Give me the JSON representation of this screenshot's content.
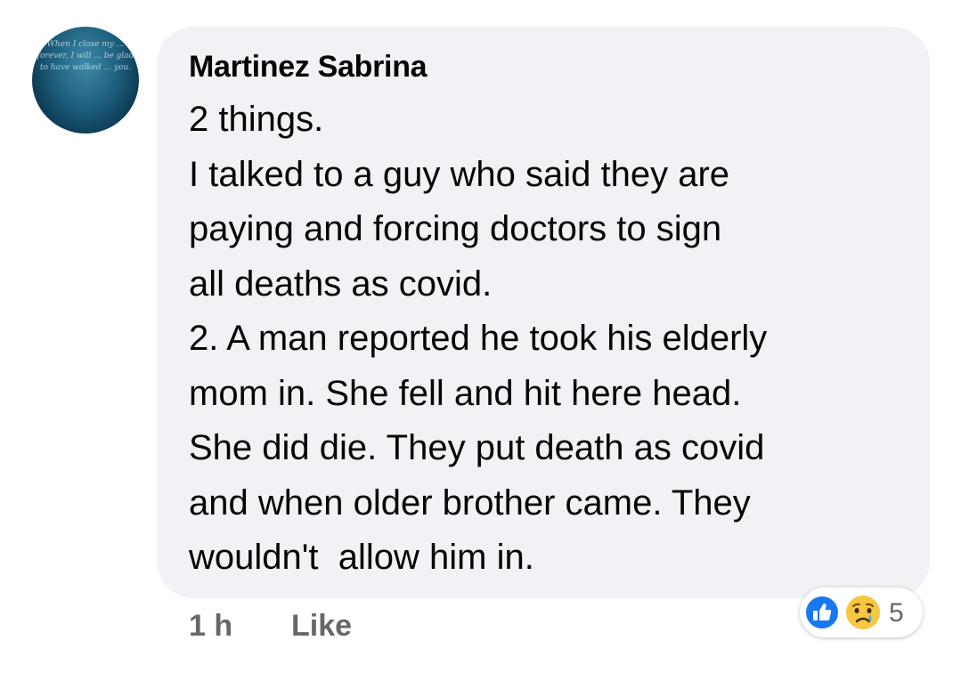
{
  "comment": {
    "author": "Martinez Sabrina",
    "body_lines": [
      "2 things.",
      "I talked to a guy who said they are",
      "paying and forcing doctors to sign",
      "all deaths as covid.",
      "2. A man reported he took his elderly",
      "mom in. She fell and hit here head.",
      "She did die. They put death as covid",
      "and when older brother came. They",
      "wouldn't  allow him in."
    ],
    "avatar_text": "When I close my ... forever, I will ... be glad to have walked ... you."
  },
  "actions": {
    "time": "1 h",
    "like_label": "Like"
  },
  "reactions": {
    "icons": [
      "like-icon",
      "sad-icon"
    ],
    "count": "5"
  },
  "colors": {
    "bubble_bg": "#f0f2f5",
    "text": "#050505",
    "secondary_text": "#65676b",
    "like_blue": "#1877f2",
    "sad_yellow": "#f7c740"
  }
}
